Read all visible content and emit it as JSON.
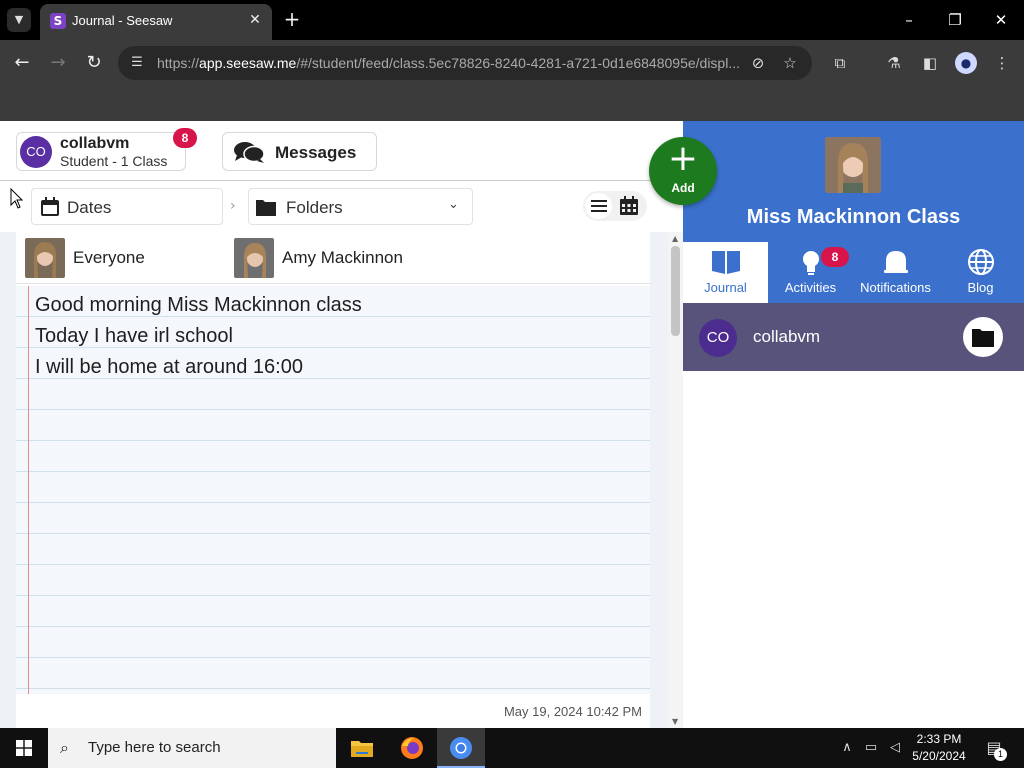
{
  "browser": {
    "tab_list_icon": "chevron-down-icon",
    "tab_title": "Journal - Seesaw",
    "tab_favicon_letter": "S",
    "url_prefix": "https://",
    "url_host": "app.seesaw.me",
    "url_path": "/#/student/feed/class.5ec78826-8240-4281-a721-0d1e6848095e/displ...",
    "window_controls": [
      "minimize-icon",
      "restore-icon",
      "close-icon"
    ]
  },
  "header": {
    "account_initials": "CO",
    "account_name": "collabvm",
    "account_subtitle": "Student - 1 Class",
    "account_badge": "8",
    "messages_label": "Messages",
    "add_label": "Add"
  },
  "filters": {
    "dates_label": "Dates",
    "folders_label": "Folders"
  },
  "post": {
    "audience": [
      {
        "name": "Everyone"
      },
      {
        "name": "Amy Mackinnon"
      }
    ],
    "lines": [
      "Good morning Miss Mackinnon class",
      "Today I have irl school",
      "I will be home at around 16:00"
    ],
    "timestamp": "May 19, 2024 10:42 PM"
  },
  "class_panel": {
    "class_name": "Miss Mackinnon Class",
    "tabs": [
      {
        "label": "Journal",
        "icon": "book-icon",
        "active": true
      },
      {
        "label": "Activities",
        "icon": "lightbulb-icon",
        "badge": "8"
      },
      {
        "label": "Notifications",
        "icon": "bell-icon"
      },
      {
        "label": "Blog",
        "icon": "globe-icon"
      }
    ],
    "student_initials": "CO",
    "student_name": "collabvm"
  },
  "taskbar": {
    "search_placeholder": "Type here to search",
    "time": "2:33 PM",
    "date": "5/20/2024",
    "notification_count": "1"
  },
  "colors": {
    "seesaw_blue": "#3b71cc",
    "add_green": "#1e7a1e",
    "badge_red": "#d8154a",
    "avatar_purple": "#5a2fa3"
  }
}
